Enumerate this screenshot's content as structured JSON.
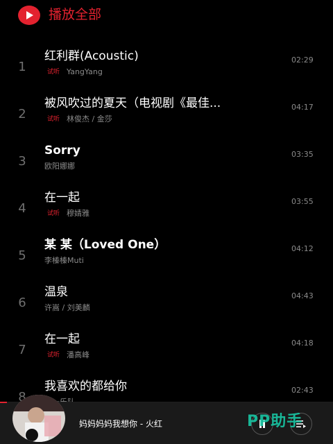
{
  "header": {
    "play_all_label": "播放全部",
    "accent": "#e3222f"
  },
  "songs": [
    {
      "index": "1",
      "title": "红利群(Acoustic)",
      "badge": "试听",
      "artist": "YangYang",
      "duration": "02:29"
    },
    {
      "index": "2",
      "title": "被风吹过的夏天（电视剧《最佳...",
      "badge": "试听",
      "artist": "林俊杰 / 金莎",
      "duration": "04:17"
    },
    {
      "index": "3",
      "title": "Sorry",
      "badge": "",
      "artist": "欧阳娜娜",
      "duration": "03:35"
    },
    {
      "index": "4",
      "title": "在一起",
      "badge": "试听",
      "artist": "穆婧雅",
      "duration": "03:55"
    },
    {
      "index": "5",
      "title": "某 某（Loved One）",
      "badge": "",
      "artist": "李榛榛Muti",
      "duration": "04:12"
    },
    {
      "index": "6",
      "title": "温泉",
      "badge": "",
      "artist": "许嵩 / 刘美麟",
      "duration": "04:43"
    },
    {
      "index": "7",
      "title": "在一起",
      "badge": "试听",
      "artist": "潘高峰",
      "duration": "04:18"
    },
    {
      "index": "8",
      "title": "我喜欢的都给你",
      "badge": "",
      "artist": "…一乐队",
      "duration": "02:43"
    }
  ],
  "player": {
    "now_playing": "妈妈妈妈我想你 - 火红",
    "progress_fraction": 0.02,
    "watermark": "PP助手"
  }
}
